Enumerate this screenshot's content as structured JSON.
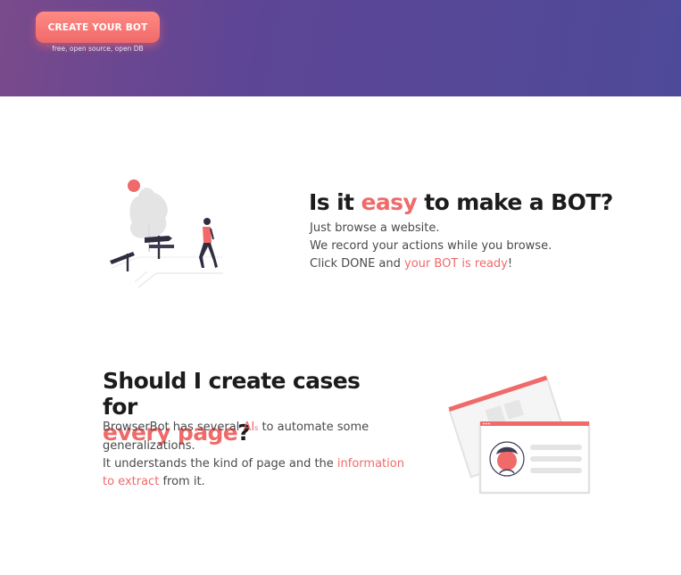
{
  "hero": {
    "cta_label": "CREATE YOUR BOT",
    "cta_subtitle": "free, open source, open DB"
  },
  "section_easy": {
    "title_prefix": "Is it ",
    "title_accent": "easy",
    "title_suffix": " to make a BOT?",
    "line1": "Just browse a website.",
    "line2": "We record your actions while you browse.",
    "line3_prefix": "Click DONE and ",
    "line3_accent": "your BOT is ready",
    "line3_suffix": "!"
  },
  "section_cases": {
    "title_line1": "Should I create cases for",
    "title_accent": "every page",
    "title_suffix": "?",
    "p1_prefix": "BrowserBot has several ",
    "p1_accent": "AI",
    "p1_accent_sub": "s",
    "p1_suffix": " to automate some generalizations.",
    "p2_prefix": "It understands the kind of page and the ",
    "p2_accent": "information to extract",
    "p2_suffix": " from it."
  },
  "colors": {
    "accent": "#f06a6a",
    "hero_start": "#7a4a8c",
    "hero_end": "#4e4a99",
    "heading": "#1c1c1c",
    "body": "#4a4a4a"
  },
  "icons": {
    "illustration_easy": "signpost-walker-illustration",
    "illustration_cases": "browser-windows-profile-illustration"
  }
}
